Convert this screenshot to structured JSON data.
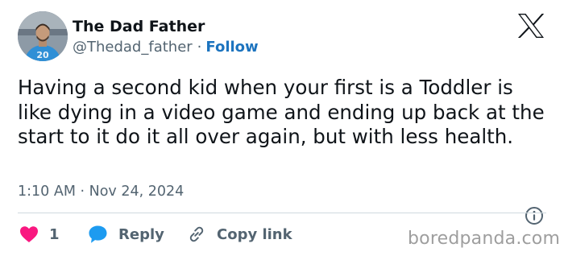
{
  "user": {
    "display_name": "The Dad Father",
    "handle": "@Thedad_father",
    "separator": "·",
    "follow_label": "Follow"
  },
  "tweet": {
    "text": "Having a second kid when your first is a Toddler is like dying in a video game and ending up back at the start to it do it all over again, but with less health.",
    "timestamp": "1:10 AM · Nov 24, 2024"
  },
  "actions": {
    "like_count": "1",
    "reply_label": "Reply",
    "copy_label": "Copy link"
  },
  "watermark": "boredpanda.com",
  "colors": {
    "text": "#0f1419",
    "secondary": "#536471",
    "follow": "#1d74bf",
    "like": "#f91880",
    "reply": "#1d9bf0",
    "divider": "#cfd9de"
  },
  "icons": [
    "x-logo-icon",
    "heart-icon",
    "reply-bubble-icon",
    "link-icon",
    "info-icon"
  ]
}
